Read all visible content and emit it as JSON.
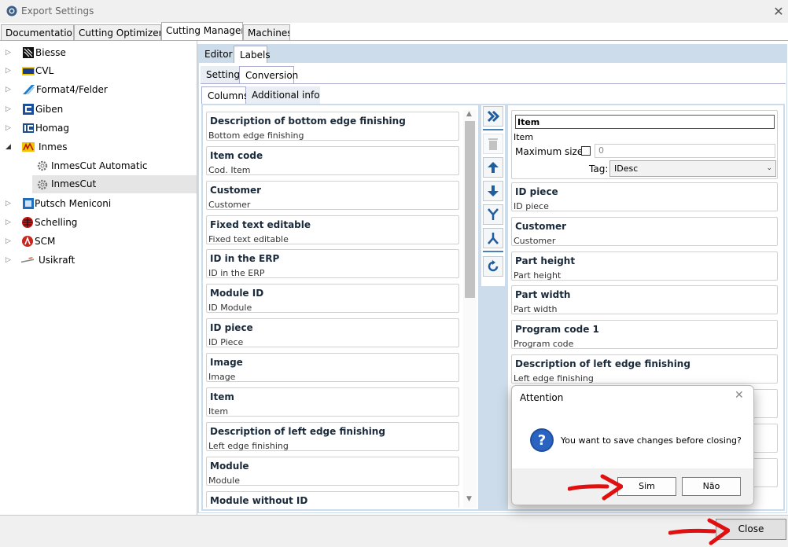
{
  "window": {
    "title": "Export Settings"
  },
  "top_tabs": [
    {
      "label": "Documentation"
    },
    {
      "label": "Cutting Optimizers"
    },
    {
      "label": "Cutting Manager"
    },
    {
      "label": "Machines"
    }
  ],
  "tree": [
    {
      "label": "Biesse"
    },
    {
      "label": "CVL"
    },
    {
      "label": "Format4/Felder"
    },
    {
      "label": "Giben"
    },
    {
      "label": "Homag"
    },
    {
      "label": "Inmes"
    },
    {
      "label": "InmesCut Automatic"
    },
    {
      "label": "InmesCut"
    },
    {
      "label": "Putsch Meniconi"
    },
    {
      "label": "Schelling"
    },
    {
      "label": "SCM"
    },
    {
      "label": "Usikraft"
    }
  ],
  "subtabs1": [
    {
      "label": "Editor"
    },
    {
      "label": "Labels"
    }
  ],
  "subtabs2": [
    {
      "label": "Setting"
    },
    {
      "label": "Conversion"
    }
  ],
  "subtabs3": [
    {
      "label": "Columns"
    },
    {
      "label": "Additional info"
    }
  ],
  "available": [
    {
      "title": "Description of bottom edge finishing",
      "sub": "Bottom edge finishing"
    },
    {
      "title": "Item code",
      "sub": "Cod. Item"
    },
    {
      "title": "Customer",
      "sub": "Customer"
    },
    {
      "title": "Fixed text editable",
      "sub": "Fixed text editable"
    },
    {
      "title": "ID in the ERP",
      "sub": "ID in the ERP"
    },
    {
      "title": "Module ID",
      "sub": "ID Module"
    },
    {
      "title": "ID piece",
      "sub": "ID Piece"
    },
    {
      "title": "Image",
      "sub": "Image"
    },
    {
      "title": "Item",
      "sub": "Item"
    },
    {
      "title": "Description of left edge finishing",
      "sub": "Left edge finishing"
    },
    {
      "title": "Module",
      "sub": "Module"
    },
    {
      "title": "Module without ID",
      "sub": ""
    }
  ],
  "selected_item": {
    "name_value": "Item",
    "sub": "Item",
    "max_size_label": "Maximum size:",
    "max_size_value": "0",
    "tag_label": "Tag:",
    "tag_value": "IDesc"
  },
  "selected": [
    {
      "title": "ID piece",
      "sub": "ID piece"
    },
    {
      "title": "Customer",
      "sub": "Customer"
    },
    {
      "title": "Part height",
      "sub": "Part height"
    },
    {
      "title": "Part width",
      "sub": "Part width"
    },
    {
      "title": "Program code 1",
      "sub": "Program code"
    },
    {
      "title": "Description of left edge finishing",
      "sub": "Left edge finishing"
    }
  ],
  "dialog": {
    "title": "Attention",
    "message": "You want to save changes before closing?",
    "yes_label": "Sim",
    "no_label": "Não"
  },
  "footer": {
    "close_label": "Close"
  },
  "colors": {
    "accent": "#2c6fb5",
    "annotation_arrow": "#e01010",
    "pane_bg": "#cddcea"
  }
}
